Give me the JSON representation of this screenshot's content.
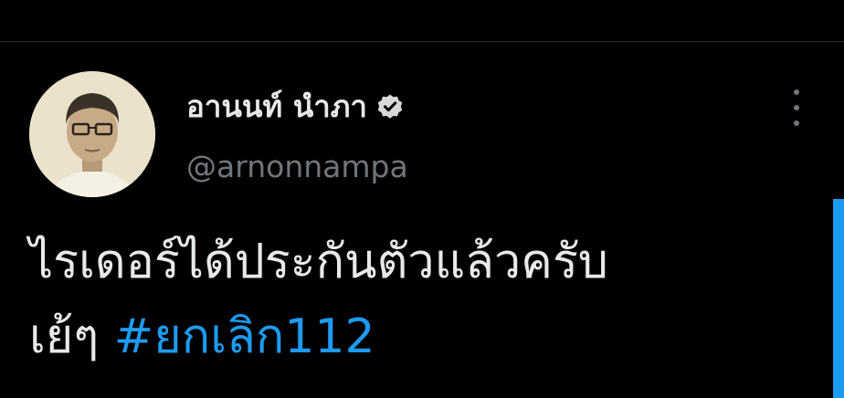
{
  "tweet": {
    "author": {
      "display_name": "อานนท์ นำภา",
      "handle": "@arnonnampa",
      "verified": true,
      "verified_icon": "verified-badge-icon",
      "avatar": "avatar-photo"
    },
    "more_icon": "more-vertical-icon",
    "text_line1": "ไรเดอร์ได้ประกันตัวแล้วครับ",
    "text_line2_prefix": "เย้ๆ ",
    "hashtag": "#ยกเลิก112"
  },
  "colors": {
    "background": "#000000",
    "text": "#e7e9ea",
    "secondary_text": "#71767b",
    "accent": "#1d9bf0",
    "divider": "#2f3336"
  }
}
